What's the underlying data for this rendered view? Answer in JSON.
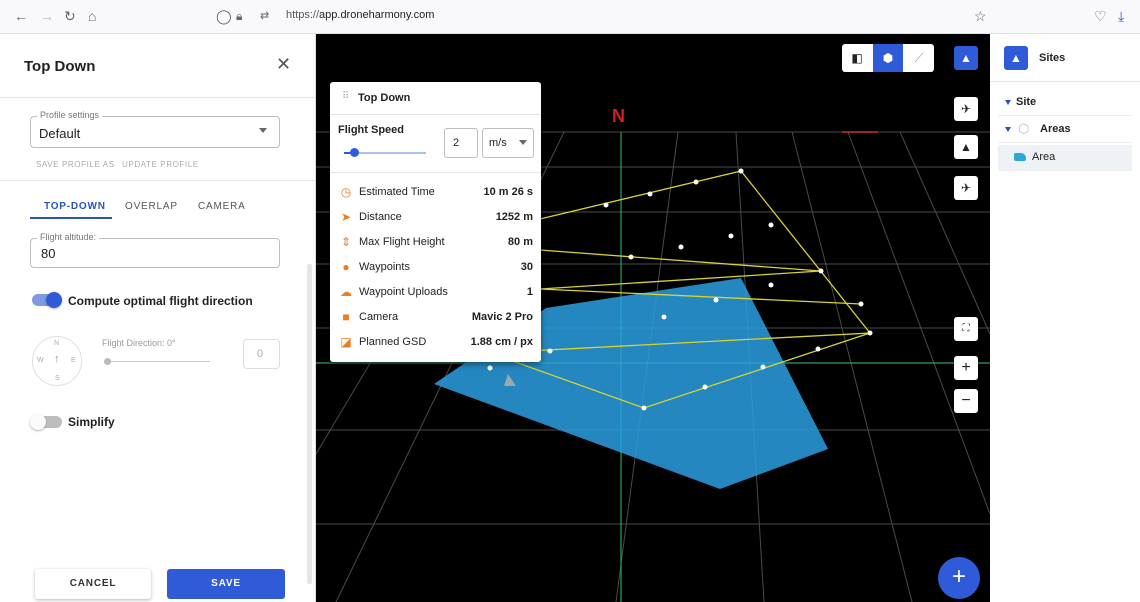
{
  "browser": {
    "url_prefix": "https://",
    "url_host": "app.droneharmony.com"
  },
  "left_panel": {
    "title": "Top Down",
    "profile": {
      "label": "Profile settings",
      "value": "Default"
    },
    "save_profile_as": "SAVE PROFILE AS",
    "update_profile": "UPDATE PROFILE",
    "tabs": [
      {
        "label": "TOP-DOWN",
        "active": true
      },
      {
        "label": "OVERLAP",
        "active": false
      },
      {
        "label": "CAMERA",
        "active": false
      }
    ],
    "altitude": {
      "label": "Flight altitude:",
      "value": "80"
    },
    "compute_optimal": {
      "label": "Compute optimal flight direction",
      "on": true
    },
    "compass": {
      "n": "N",
      "e": "E",
      "s": "S",
      "w": "W"
    },
    "flight_direction": {
      "label": "Flight Direction: 0°",
      "value": "0"
    },
    "simplify": {
      "label": "Simplify",
      "on": false
    },
    "cancel": "CANCEL",
    "save": "SAVE"
  },
  "popup": {
    "title": "Top Down",
    "flight_speed": {
      "label": "Flight Speed",
      "value": "2",
      "unit": "m/s"
    },
    "stats": [
      {
        "icon": "clock-icon",
        "label": "Estimated Time",
        "value": "10 m 26 s"
      },
      {
        "icon": "navigation-arrow-icon",
        "label": "Distance",
        "value": "1252 m"
      },
      {
        "icon": "height-icon",
        "label": "Max Flight Height",
        "value": "80 m"
      },
      {
        "icon": "pin-icon",
        "label": "Waypoints",
        "value": "30"
      },
      {
        "icon": "cloud-upload-icon",
        "label": "Waypoint Uploads",
        "value": "1"
      },
      {
        "icon": "camera-icon",
        "label": "Camera",
        "value": "Mavic 2 Pro"
      },
      {
        "icon": "gsd-icon",
        "label": "Planned GSD",
        "value": "1.88 cm / px"
      }
    ]
  },
  "map": {
    "north_label": "N"
  },
  "right_panel": {
    "title": "Sites",
    "tree": [
      {
        "label": "Site"
      },
      {
        "label": "Areas"
      },
      {
        "label": "Area"
      }
    ]
  },
  "colors": {
    "accent": "#2f5bd8",
    "orange": "#f07a1a",
    "area_fill": "#2a9fe0",
    "flight_path": "#d8d234"
  }
}
